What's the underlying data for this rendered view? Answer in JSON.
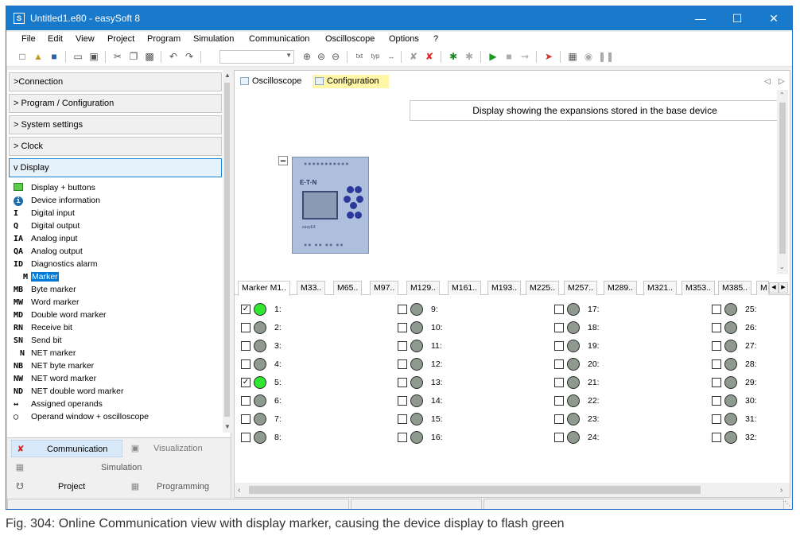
{
  "window": {
    "title": "Untitled1.e80 - easySoft 8",
    "app_icon": "easysoft-logo-icon"
  },
  "menu": [
    "File",
    "Edit",
    "View",
    "Project",
    "Program",
    "Simulation",
    "Communication",
    "Oscilloscope",
    "Options",
    "?"
  ],
  "left_panel": {
    "sections": [
      ">Connection",
      "> Program / Configuration",
      "> System settings",
      "> Clock",
      "v Display"
    ],
    "tree": [
      {
        "icon": "",
        "label": "Display + buttons"
      },
      {
        "icon": "",
        "label": "Device information"
      },
      {
        "icon": "I",
        "label": "Digital input"
      },
      {
        "icon": "Q",
        "label": "Digital output"
      },
      {
        "icon": "IA",
        "label": "Analog input"
      },
      {
        "icon": "QA",
        "label": "Analog output"
      },
      {
        "icon": "ID",
        "label": "Diagnostics alarm"
      },
      {
        "icon": "M",
        "label": "Marker"
      },
      {
        "icon": "MB",
        "label": "Byte marker"
      },
      {
        "icon": "MW",
        "label": "Word marker"
      },
      {
        "icon": "MD",
        "label": "Double word marker"
      },
      {
        "icon": "RN",
        "label": "Receive bit"
      },
      {
        "icon": "SN",
        "label": "Send bit"
      },
      {
        "icon": "N",
        "label": "NET marker"
      },
      {
        "icon": "NB",
        "label": "NET byte marker"
      },
      {
        "icon": "NW",
        "label": "NET word marker"
      },
      {
        "icon": "ND",
        "label": "NET double word marker"
      },
      {
        "icon": "↔",
        "label": "Assigned operands"
      },
      {
        "icon": "",
        "label": "Operand window + oscilloscope"
      }
    ],
    "nav": {
      "communication": "Communication",
      "visualization": "Visualization",
      "simulation": "Simulation",
      "project": "Project",
      "programming": "Programming"
    }
  },
  "right_panel": {
    "tabs": [
      "Oscilloscope",
      "Configuration"
    ],
    "active_tab": "Configuration",
    "display_caption": "Display showing the expansions stored in the base device",
    "device": {
      "brand": "E·T·N",
      "model": "easyE4"
    },
    "marker_tabs": [
      "Marker M1..",
      "M33..",
      "M65..",
      "M97..",
      "M129..",
      "M161..",
      "M193..",
      "M225..",
      "M257..",
      "M289..",
      "M321..",
      "M353..",
      "M385..",
      "M"
    ],
    "markers": [
      {
        "label": "1:",
        "checked": true,
        "on": true
      },
      {
        "label": "2:",
        "checked": false,
        "on": false
      },
      {
        "label": "3:",
        "checked": false,
        "on": false
      },
      {
        "label": "4:",
        "checked": false,
        "on": false
      },
      {
        "label": "5:",
        "checked": true,
        "on": true
      },
      {
        "label": "6:",
        "checked": false,
        "on": false
      },
      {
        "label": "7:",
        "checked": false,
        "on": false
      },
      {
        "label": "8:",
        "checked": false,
        "on": false
      },
      {
        "label": "9:",
        "checked": false,
        "on": false
      },
      {
        "label": "10:",
        "checked": false,
        "on": false
      },
      {
        "label": "11:",
        "checked": false,
        "on": false
      },
      {
        "label": "12:",
        "checked": false,
        "on": false
      },
      {
        "label": "13:",
        "checked": false,
        "on": false
      },
      {
        "label": "14:",
        "checked": false,
        "on": false
      },
      {
        "label": "15:",
        "checked": false,
        "on": false
      },
      {
        "label": "16:",
        "checked": false,
        "on": false
      },
      {
        "label": "17:",
        "checked": false,
        "on": false
      },
      {
        "label": "18:",
        "checked": false,
        "on": false
      },
      {
        "label": "19:",
        "checked": false,
        "on": false
      },
      {
        "label": "20:",
        "checked": false,
        "on": false
      },
      {
        "label": "21:",
        "checked": false,
        "on": false
      },
      {
        "label": "22:",
        "checked": false,
        "on": false
      },
      {
        "label": "23:",
        "checked": false,
        "on": false
      },
      {
        "label": "24:",
        "checked": false,
        "on": false
      },
      {
        "label": "25:",
        "checked": false,
        "on": false
      },
      {
        "label": "26:",
        "checked": false,
        "on": false
      },
      {
        "label": "27:",
        "checked": false,
        "on": false
      },
      {
        "label": "28:",
        "checked": false,
        "on": false
      },
      {
        "label": "29:",
        "checked": false,
        "on": false
      },
      {
        "label": "30:",
        "checked": false,
        "on": false
      },
      {
        "label": "31:",
        "checked": false,
        "on": false
      },
      {
        "label": "32:",
        "checked": false,
        "on": false
      }
    ]
  },
  "caption": "Fig. 304: Online Communication view with display marker, causing the device display to flash green",
  "colors": {
    "titlebar": "#1979ca",
    "lamp_on": "#30e632",
    "lamp_off": "#8e9a8d",
    "selection": "#0078d7",
    "active_tab": "#fff6a8"
  }
}
